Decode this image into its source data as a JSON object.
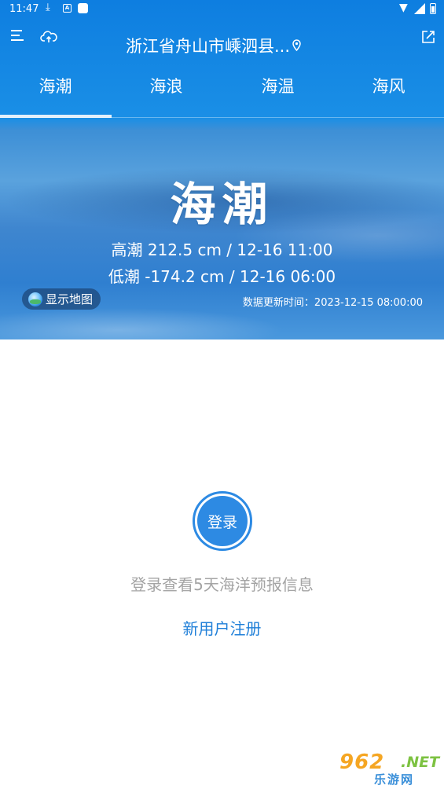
{
  "status_bar": {
    "time": "11:47",
    "download_icon": "download-icon",
    "a_icon": "A"
  },
  "header": {
    "location": "浙江省舟山市嵊泗县...",
    "menu_icon": "menu-icon",
    "cloud_icon": "cloud-upload-icon",
    "pin_icon": "location-pin-icon",
    "share_icon": "share-icon"
  },
  "tabs": [
    {
      "label": "海潮",
      "active": true
    },
    {
      "label": "海浪",
      "active": false
    },
    {
      "label": "海温",
      "active": false
    },
    {
      "label": "海风",
      "active": false
    }
  ],
  "hero": {
    "title": "海潮",
    "high_tide": "高潮 212.5 cm / 12-16 11:00",
    "low_tide": "低潮 -174.2 cm / 12-16 06:00",
    "map_button": "显示地图",
    "update_time": "数据更新时间：2023-12-15 08:00:00"
  },
  "login": {
    "button": "登录",
    "hint": "登录查看5天海洋预报信息",
    "register": "新用户注册"
  },
  "watermark": {
    "number": "962",
    "net": ".NET",
    "cn": "乐游网"
  },
  "colors": {
    "header_blue": "#0e7ee0",
    "login_blue": "#2d8ae3",
    "link_blue": "#1f7fd8",
    "hint_gray": "#a4a4a4"
  }
}
